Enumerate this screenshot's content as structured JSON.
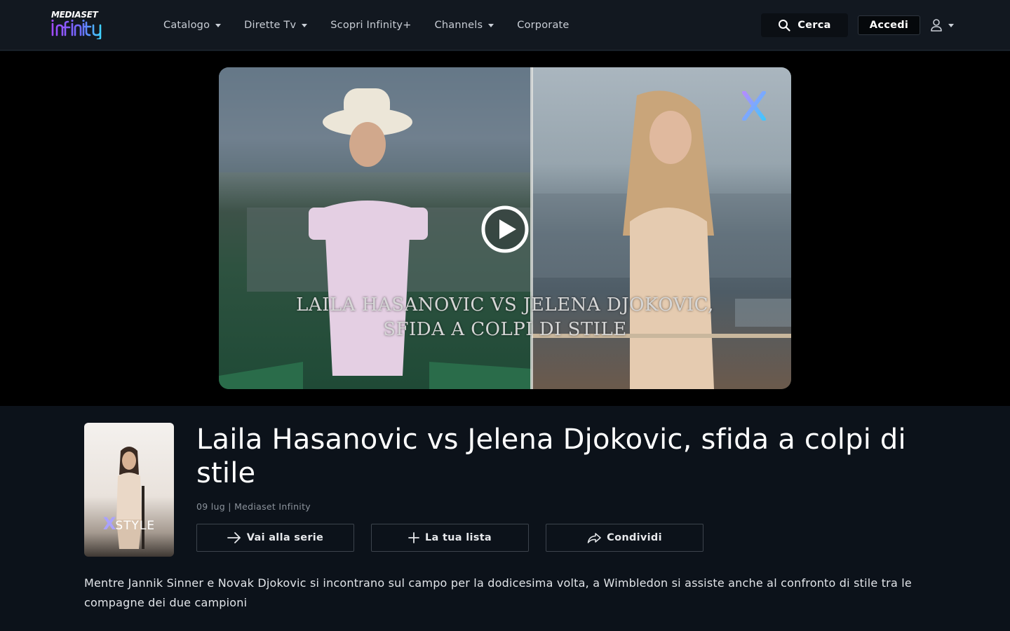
{
  "header": {
    "logo_top": "MEDIASET",
    "logo_bottom": "infinity",
    "nav": [
      {
        "label": "Catalogo",
        "dropdown": true
      },
      {
        "label": "Dirette Tv",
        "dropdown": true
      },
      {
        "label": "Scopri Infinity+",
        "dropdown": false
      },
      {
        "label": "Channels",
        "dropdown": true
      },
      {
        "label": "Corporate",
        "dropdown": false
      }
    ],
    "search_label": "Cerca",
    "login_label": "Accedi"
  },
  "player": {
    "overlay_text_line1": "LAILA HASANOVIC VS JELENA DJOKOVIC,",
    "overlay_text_line2": "SFIDA A COLPI DI STILE",
    "brand_mark": "X"
  },
  "content": {
    "thumb_label_x": "X",
    "thumb_label": "STYLE",
    "title": "Laila Hasanovic vs Jelena Djokovic, sfida a colpi di stile",
    "meta": "09 lug | Mediaset Infinity",
    "actions": [
      {
        "label": "Vai alla serie",
        "icon": "arrow-right-icon"
      },
      {
        "label": "La tua lista",
        "icon": "plus-icon"
      },
      {
        "label": "Condividi",
        "icon": "share-icon"
      }
    ],
    "description": "Mentre Jannik Sinner e Novak Djokovic si incontrano sul campo per la dodicesima volta, a Wimbledon si assiste anche al confronto di stile tra le compagne dei due campioni"
  },
  "colors": {
    "background": "#0c121a",
    "header": "#121820",
    "logo_gradient": [
      "#9b4dff",
      "#3fd1ff"
    ]
  }
}
